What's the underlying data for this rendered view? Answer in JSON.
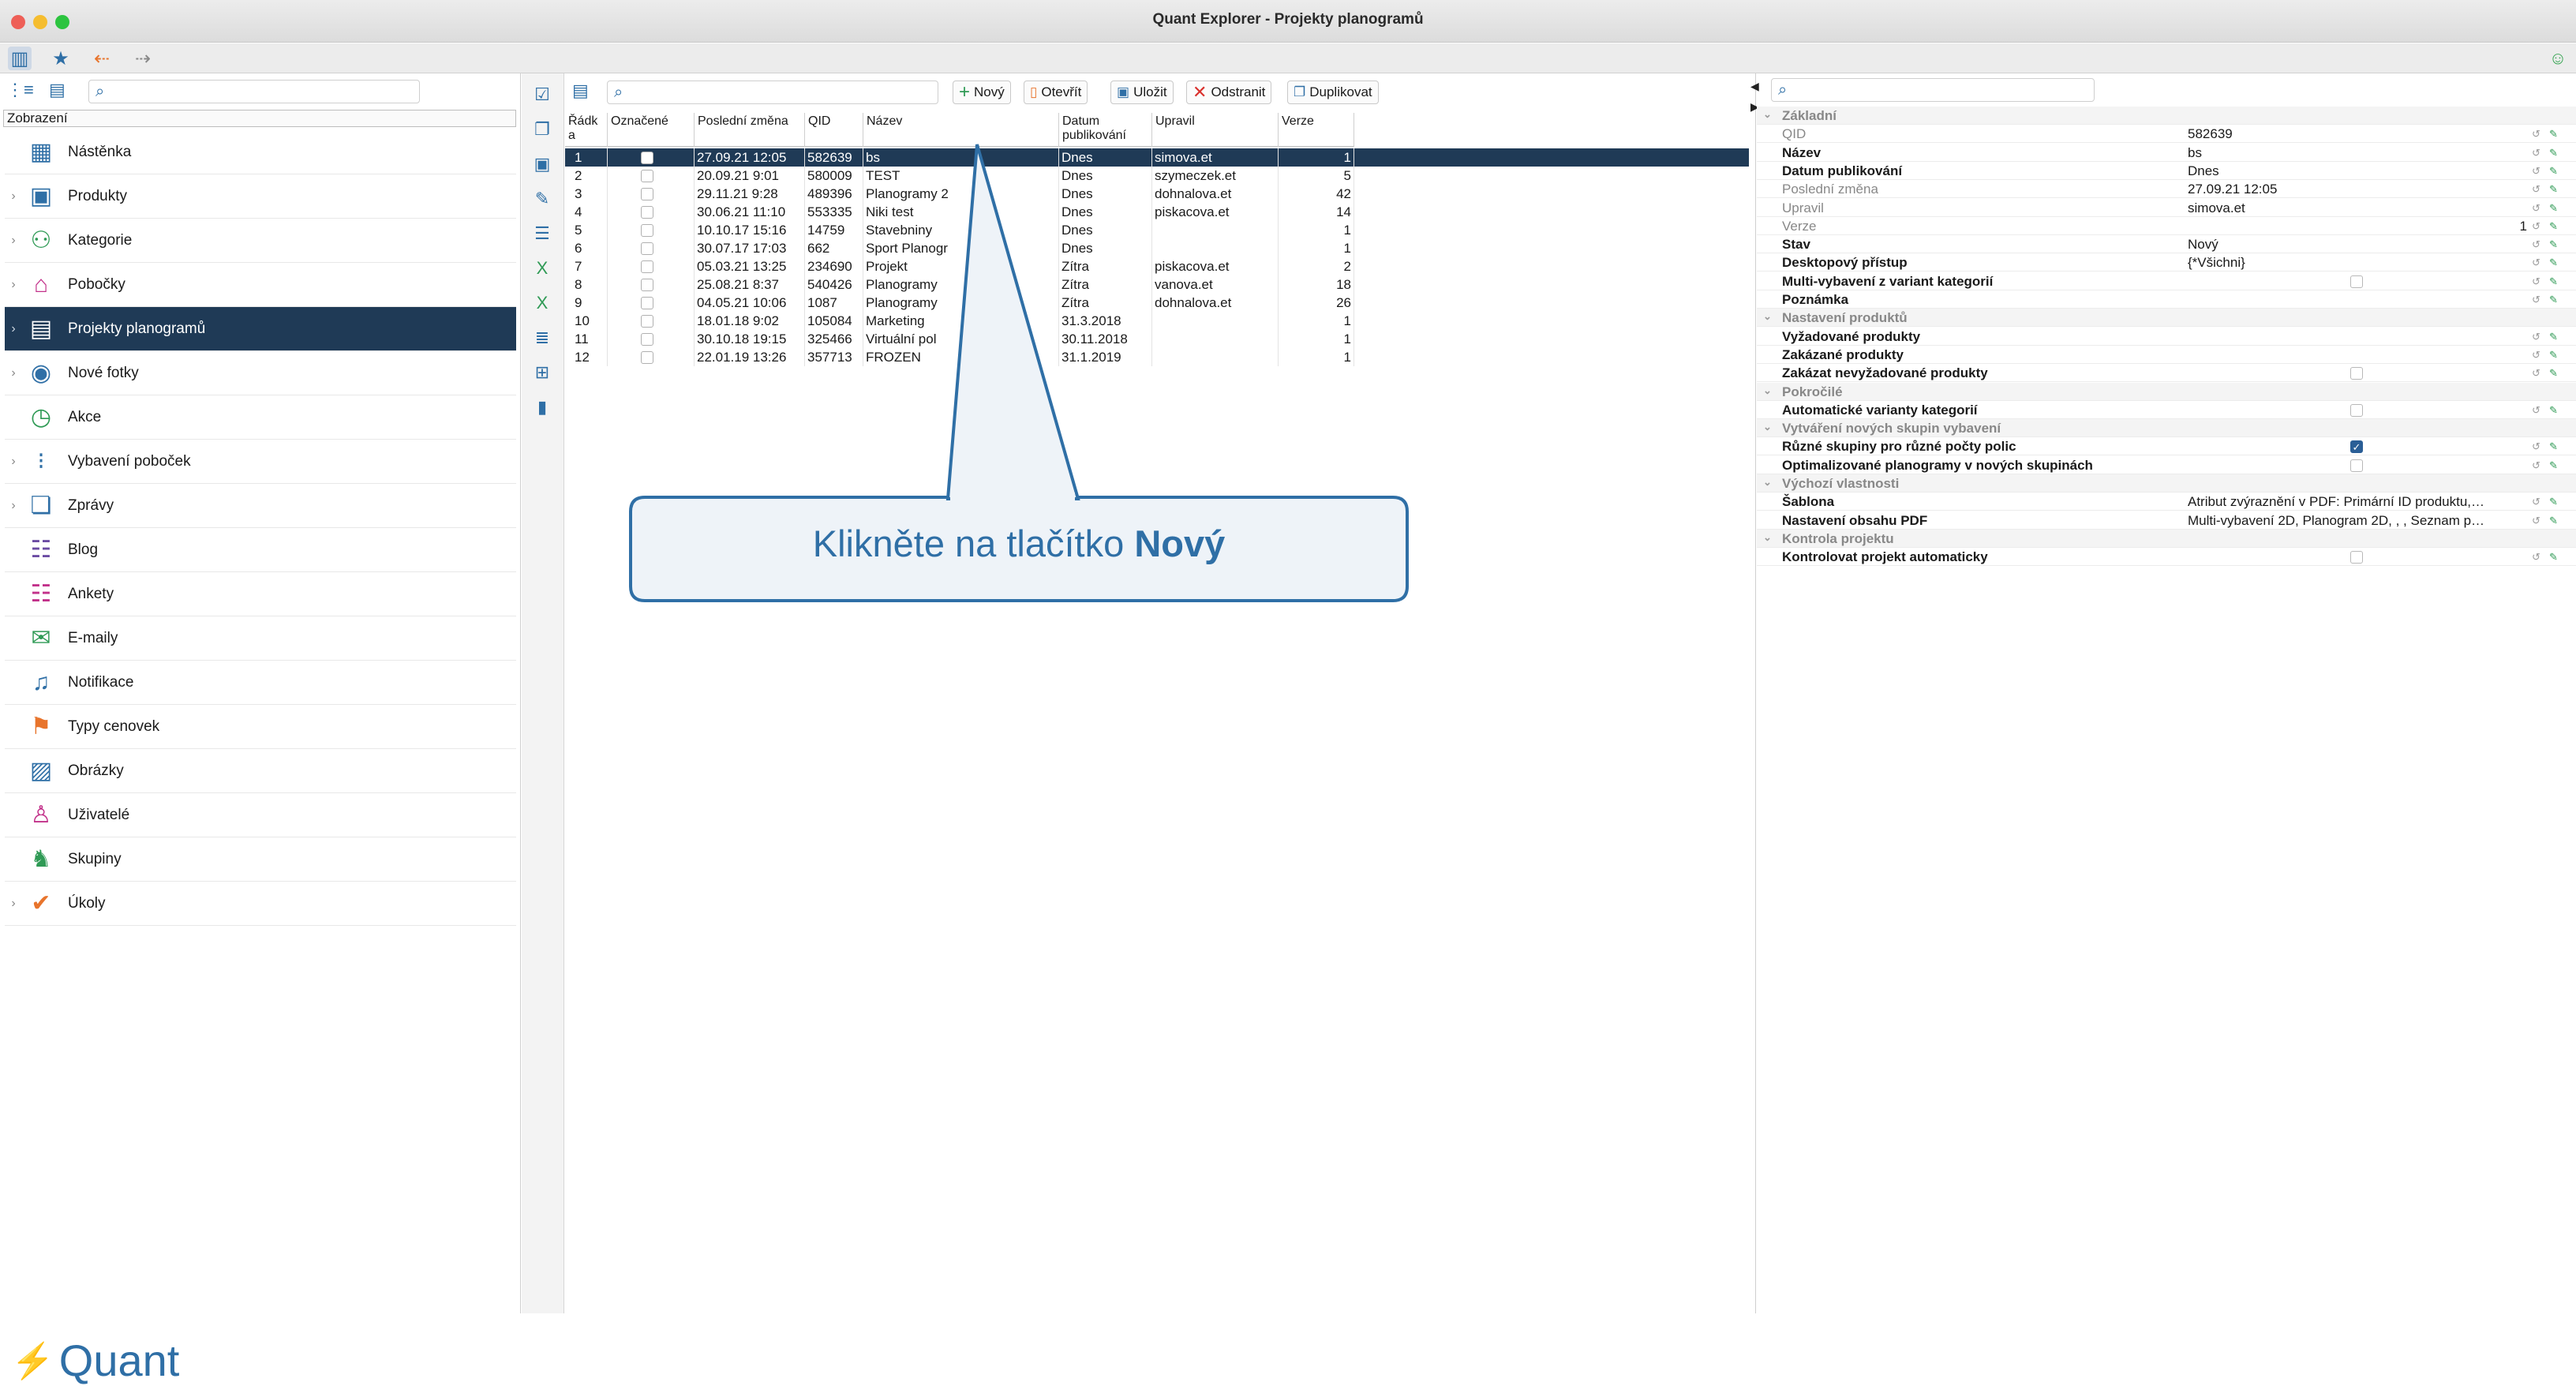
{
  "window": {
    "title": "Quant Explorer - Projekty planogramů"
  },
  "left": {
    "view_label": "Zobrazení",
    "items": [
      {
        "label": "Nástěnka",
        "icon": "dashboard-icon",
        "arrow": false
      },
      {
        "label": "Produkty",
        "icon": "product-icon",
        "arrow": true
      },
      {
        "label": "Kategorie",
        "icon": "category-icon",
        "arrow": true
      },
      {
        "label": "Pobočky",
        "icon": "store-icon",
        "arrow": true
      },
      {
        "label": "Projekty planogramů",
        "icon": "planogram-icon",
        "arrow": true
      },
      {
        "label": "Nové fotky",
        "icon": "camera-icon",
        "arrow": true
      },
      {
        "label": "Akce",
        "icon": "clock-icon",
        "arrow": false
      },
      {
        "label": "Vybavení poboček",
        "icon": "equipment-icon",
        "arrow": true
      },
      {
        "label": "Zprávy",
        "icon": "messages-icon",
        "arrow": true
      },
      {
        "label": "Blog",
        "icon": "blog-icon",
        "arrow": false
      },
      {
        "label": "Ankety",
        "icon": "survey-icon",
        "arrow": false
      },
      {
        "label": "E-maily",
        "icon": "mail-icon",
        "arrow": false
      },
      {
        "label": "Notifikace",
        "icon": "bell-icon",
        "arrow": false
      },
      {
        "label": "Typy cenovek",
        "icon": "price-tag-icon",
        "arrow": false
      },
      {
        "label": "Obrázky",
        "icon": "image-icon",
        "arrow": false
      },
      {
        "label": "Uživatelé",
        "icon": "user-icon",
        "arrow": false
      },
      {
        "label": "Skupiny",
        "icon": "group-icon",
        "arrow": false
      },
      {
        "label": "Úkoly",
        "icon": "task-icon",
        "arrow": true
      }
    ],
    "logo_text": "Quant"
  },
  "middle": {
    "buttons": {
      "new": "Nový",
      "open": "Otevřít",
      "save": "Uložit",
      "delete": "Odstranit",
      "duplicate": "Duplikovat"
    },
    "columns": [
      "Řádk\na",
      "Označené",
      "Poslední změna",
      "QID",
      "Název",
      "Datum\npublikování",
      "Upravil",
      "Verze"
    ],
    "rows": [
      {
        "n": "1",
        "changed": "27.09.21 12:05",
        "qid": "582639",
        "name": "bs",
        "published": "Dnes",
        "by": "simova.et",
        "version": "1"
      },
      {
        "n": "2",
        "changed": "20.09.21 9:01",
        "qid": "580009",
        "name": "TEST",
        "published": "Dnes",
        "by": "szymeczek.et",
        "version": "5"
      },
      {
        "n": "3",
        "changed": "29.11.21 9:28",
        "qid": "489396",
        "name": "Planogramy 2",
        "published": "Dnes",
        "by": "dohnalova.et",
        "version": "42"
      },
      {
        "n": "4",
        "changed": "30.06.21 11:10",
        "qid": "553335",
        "name": "Niki test",
        "published": "Dnes",
        "by": "piskacova.et",
        "version": "14"
      },
      {
        "n": "5",
        "changed": "10.10.17 15:16",
        "qid": "14759",
        "name": "Stavebniny",
        "published": "Dnes",
        "by": "",
        "version": "1"
      },
      {
        "n": "6",
        "changed": "30.07.17 17:03",
        "qid": "662",
        "name": "Sport Planogr",
        "published": "Dnes",
        "by": "",
        "version": "1"
      },
      {
        "n": "7",
        "changed": "05.03.21 13:25",
        "qid": "234690",
        "name": "Projekt",
        "published": "Zítra",
        "by": "piskacova.et",
        "version": "2"
      },
      {
        "n": "8",
        "changed": "25.08.21 8:37",
        "qid": "540426",
        "name": "Planogramy",
        "published": "Zítra",
        "by": "vanova.et",
        "version": "18"
      },
      {
        "n": "9",
        "changed": "04.05.21 10:06",
        "qid": "1087",
        "name": "Planogramy",
        "published": "Zítra",
        "by": "dohnalova.et",
        "version": "26"
      },
      {
        "n": "10",
        "changed": "18.01.18 9:02",
        "qid": "105084",
        "name": "Marketing",
        "published": "31.3.2018",
        "by": "",
        "version": "1"
      },
      {
        "n": "11",
        "changed": "30.10.18 19:15",
        "qid": "325466",
        "name": "Virtuální pol",
        "published": "30.11.2018",
        "by": "",
        "version": "1"
      },
      {
        "n": "12",
        "changed": "22.01.19 13:26",
        "qid": "357713",
        "name": "FROZEN",
        "published": "31.1.2019",
        "by": "",
        "version": "1"
      }
    ],
    "callout": {
      "prefix": "Klikněte na tlačítko ",
      "bold": "Nový"
    }
  },
  "right": {
    "rows": [
      {
        "type": "section",
        "k": "Základní"
      },
      {
        "type": "prop",
        "k": "QID",
        "v": "582639",
        "style": "g"
      },
      {
        "type": "prop",
        "k": "Název",
        "v": "bs",
        "style": "b"
      },
      {
        "type": "prop",
        "k": "Datum publikování",
        "v": "Dnes",
        "style": "b"
      },
      {
        "type": "prop",
        "k": "Poslední změna",
        "v": "27.09.21 12:05",
        "style": "g"
      },
      {
        "type": "prop",
        "k": "Upravil",
        "v": "simova.et",
        "style": "g"
      },
      {
        "type": "prop",
        "k": "Verze",
        "v": "1",
        "style": "g",
        "align": "right"
      },
      {
        "type": "prop",
        "k": "Stav",
        "v": "Nový",
        "style": "b"
      },
      {
        "type": "prop",
        "k": "Desktopový přístup",
        "v": "{*Všichni}",
        "style": "b"
      },
      {
        "type": "check",
        "k": "Multi-vybavení z variant kategorií",
        "checked": false,
        "style": "b"
      },
      {
        "type": "prop",
        "k": "Poznámka",
        "v": "",
        "style": "b"
      },
      {
        "type": "section",
        "k": "Nastavení produktů"
      },
      {
        "type": "prop",
        "k": "Vyžadované produkty",
        "v": "",
        "style": "b"
      },
      {
        "type": "prop",
        "k": "Zakázané produkty",
        "v": "",
        "style": "b"
      },
      {
        "type": "check",
        "k": "Zakázat nevyžadované produkty",
        "checked": false,
        "style": "b"
      },
      {
        "type": "section",
        "k": "Pokročilé"
      },
      {
        "type": "check",
        "k": "Automatické varianty kategorií",
        "checked": false,
        "style": "b"
      },
      {
        "type": "section",
        "k": "Vytváření nových skupin vybavení"
      },
      {
        "type": "check",
        "k": "Různé skupiny pro různé počty polic",
        "checked": true,
        "style": "b"
      },
      {
        "type": "check",
        "k": "Optimalizované planogramy v nových skupinách",
        "checked": false,
        "style": "b"
      },
      {
        "type": "section",
        "k": "Výchozí vlastnosti"
      },
      {
        "type": "prop",
        "k": "Šablona",
        "v": "Atribut zvýraznění v PDF: Primární ID produktu,…",
        "style": "b"
      },
      {
        "type": "prop",
        "k": "Nastavení obsahu PDF",
        "v": "Multi-vybavení 2D, Planogram 2D, , , Seznam p…",
        "style": "b"
      },
      {
        "type": "section",
        "k": "Kontrola projektu"
      },
      {
        "type": "check",
        "k": "Kontrolovat projekt automaticky",
        "checked": false,
        "style": "b"
      }
    ]
  },
  "colors": {
    "accent": "#2f6fa6",
    "selection": "#1f3a56",
    "callout_fill": "#eef3f8"
  }
}
